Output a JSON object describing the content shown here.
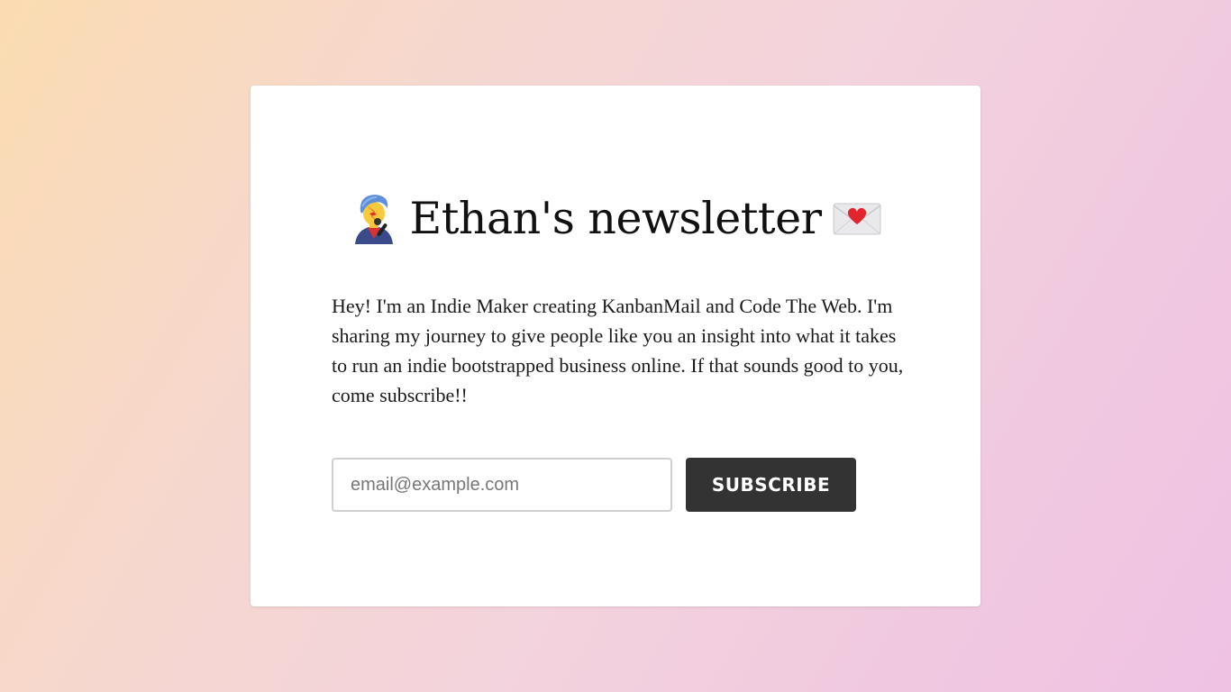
{
  "newsletter": {
    "title": "Ethan's newsletter",
    "leading_icon": "singer-emoji-icon",
    "trailing_icon": "love-letter-emoji-icon",
    "description": "Hey! I'm an Indie Maker creating KanbanMail and Code The Web. I'm sharing my journey to give people like you an insight into what it takes to run an indie bootstrapped business online. If that sounds good to you, come subscribe!!",
    "email_placeholder": "email@example.com",
    "email_value": "",
    "subscribe_label": "SUBSCRIBE"
  },
  "colors": {
    "button_bg": "#333333",
    "background_gradient_start": "#fbdcb1",
    "background_gradient_end": "#efc2e4"
  }
}
